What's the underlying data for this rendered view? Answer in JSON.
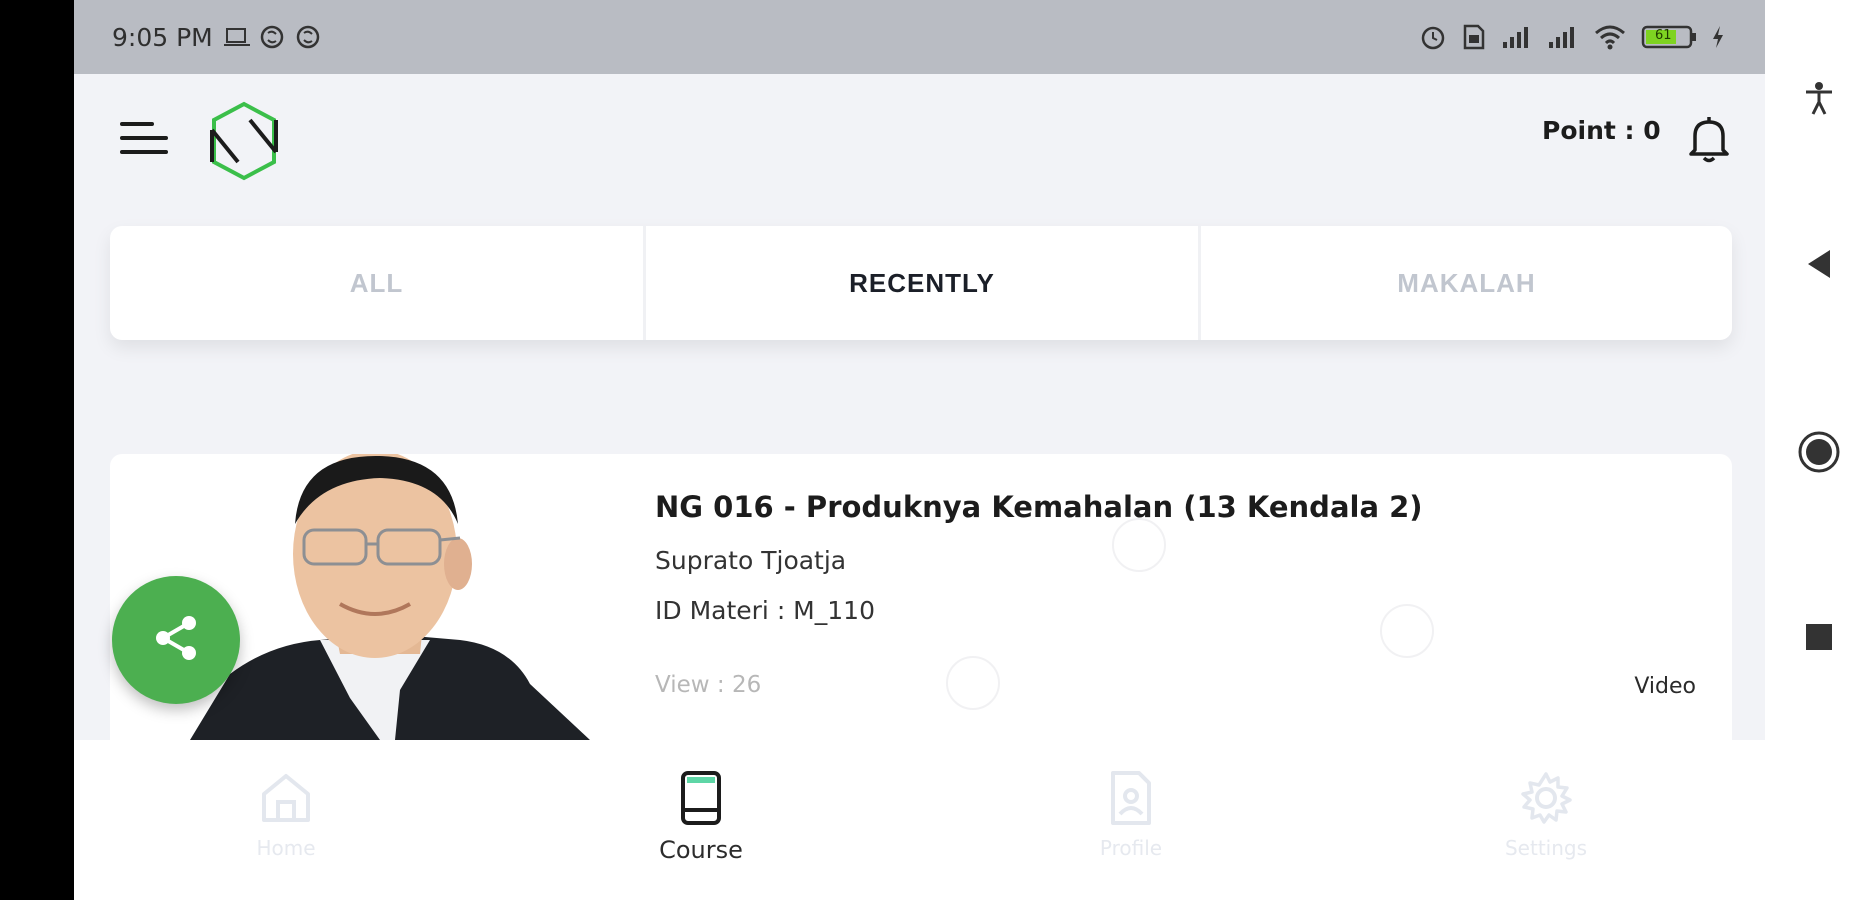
{
  "status_bar": {
    "time": "9:05 PM",
    "left_icons": [
      "laptop-icon",
      "sync-icon",
      "sync-icon"
    ],
    "right_icons": [
      "alarm-icon",
      "sim-icon",
      "signal-icon",
      "signal-icon",
      "wifi-icon",
      "battery-icon",
      "charging-icon"
    ],
    "battery_level": "61"
  },
  "header": {
    "points_label": "Point : 0",
    "logo_color": "#3bbf4a"
  },
  "tabs": [
    {
      "label": "ALL",
      "active": false
    },
    {
      "label": "RECENTLY",
      "active": true
    },
    {
      "label": "MAKALAH",
      "active": false
    }
  ],
  "course_card": {
    "title": "NG 016 - Produknya Kemahalan (13 Kendala 2)",
    "author": "Suprato Tjoatja",
    "material_id": "ID Materi : M_110",
    "views": "View : 26",
    "type": "Video"
  },
  "fab": {
    "icon": "share-icon",
    "color": "#4caf50"
  },
  "bottom_nav": [
    {
      "label": "Home",
      "icon": "home-icon",
      "active": false
    },
    {
      "label": "Course",
      "icon": "book-icon",
      "active": true
    },
    {
      "label": "Profile",
      "icon": "profile-icon",
      "active": false
    },
    {
      "label": "Settings",
      "icon": "gear-icon",
      "active": false
    }
  ],
  "system_nav": [
    "accessibility-icon",
    "back-icon",
    "home-circle-icon",
    "recents-icon"
  ]
}
